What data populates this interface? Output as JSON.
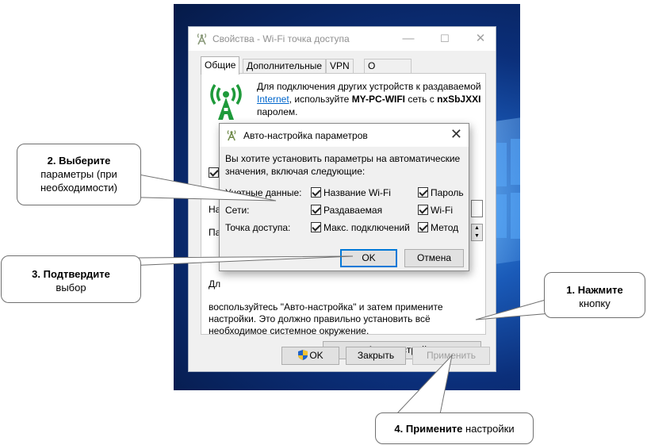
{
  "main_window": {
    "title": "Свойства - Wi-Fi точка доступа",
    "tabs": [
      {
        "label": "Общие",
        "active": true
      },
      {
        "label": "Дополнительные",
        "active": false
      },
      {
        "label": "VPN",
        "active": false
      },
      {
        "label": "О продукте",
        "active": false
      }
    ],
    "info": {
      "line_prefix": "Для подключения других устройств к раздаваемой",
      "link": "Internet",
      "middle": ", используйте",
      "ssid": "MY-PC-WIFI",
      "net_with": "сеть с",
      "password": "nxSbJXXI",
      "suffix": "паролем."
    },
    "partial_labels": {
      "na": "На",
      "pa": "Па",
      "dl": "Дл"
    },
    "hint_text": "воспользуйтесь \"Авто-настройка\" и затем примените настройки. Это должно правильно установить всё необходимое системное окружение.",
    "auto_button": "Авто-настройка",
    "ok_button": "OK",
    "close_button": "Закрыть",
    "apply_button": "Применить"
  },
  "dialog": {
    "title": "Авто-настройка параметров",
    "question": "Вы хотите установить параметры на автоматические значения, включая следующие:",
    "rows": [
      {
        "label": "Учетные данные:",
        "options": [
          "Название Wi-Fi",
          "Пароль"
        ]
      },
      {
        "label": "Сети:",
        "options": [
          "Раздаваемая",
          "Wi-Fi"
        ]
      },
      {
        "label": "Точка доступа:",
        "options": [
          "Макс. подключений",
          "Метод"
        ]
      }
    ],
    "ok_button": "OK",
    "cancel_button": "Отмена"
  },
  "callouts": {
    "c1_bold": "1. Нажмите",
    "c1_rest": "кнопку",
    "c2_bold": "2. Выберите",
    "c2_rest": "параметры (при необходимости)",
    "c3_bold": "3. Подтвердите",
    "c3_rest": "выбор",
    "c4_bold": "4. Примените",
    "c4_rest": "настройки"
  },
  "colors": {
    "accent": "#0078d7",
    "wifi_icon": "#1e9a3a",
    "link": "#0066cc"
  }
}
